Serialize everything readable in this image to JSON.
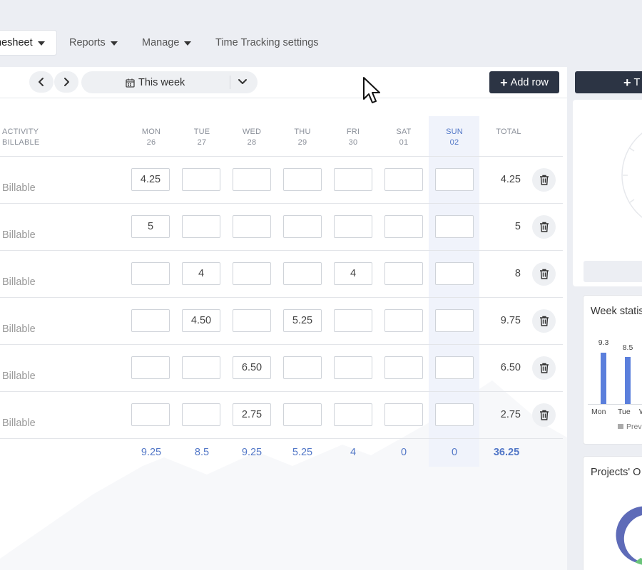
{
  "nav": {
    "tabs": [
      {
        "label": "nesheet",
        "active": true
      },
      {
        "label": "Reports",
        "active": false
      },
      {
        "label": "Manage",
        "active": false
      },
      {
        "label": "Time Tracking settings",
        "active": false
      }
    ]
  },
  "toolbar": {
    "week_label": "This week",
    "add_row_label": "Add row"
  },
  "table": {
    "activity_header": "ACTIVITY",
    "activity_subheader": "BILLABLE",
    "days": [
      {
        "name": "MON",
        "date": "26"
      },
      {
        "name": "TUE",
        "date": "27"
      },
      {
        "name": "WED",
        "date": "28"
      },
      {
        "name": "THU",
        "date": "29"
      },
      {
        "name": "FRI",
        "date": "30"
      },
      {
        "name": "SAT",
        "date": "01"
      },
      {
        "name": "SUN",
        "date": "02"
      }
    ],
    "total_header": "TOTAL",
    "rows": [
      {
        "label": "Billable",
        "cells": [
          "4.25",
          "",
          "",
          "",
          "",
          "",
          ""
        ],
        "total": "4.25"
      },
      {
        "label": "Billable",
        "cells": [
          "5",
          "",
          "",
          "",
          "",
          "",
          ""
        ],
        "total": "5"
      },
      {
        "label": "Billable",
        "cells": [
          "",
          "4",
          "",
          "",
          "4",
          "",
          ""
        ],
        "total": "8"
      },
      {
        "label": "Billable",
        "cells": [
          "",
          "4.50",
          "",
          "5.25",
          "",
          "",
          ""
        ],
        "total": "9.75"
      },
      {
        "label": "Billable",
        "cells": [
          "",
          "",
          "6.50",
          "",
          "",
          "",
          ""
        ],
        "total": "6.50"
      },
      {
        "label": "Billable",
        "cells": [
          "",
          "",
          "2.75",
          "",
          "",
          "",
          ""
        ],
        "total": "2.75"
      }
    ],
    "day_totals": [
      "9.25",
      "8.5",
      "9.25",
      "5.25",
      "4",
      "0",
      "0"
    ],
    "grand_total": "36.25"
  },
  "sidebar": {
    "button_label": "T",
    "week_stats": {
      "title": "Week statis",
      "bars": [
        {
          "day": "Mon",
          "value": "9.3"
        },
        {
          "day": "Tue",
          "value": "8.5"
        },
        {
          "day": "W",
          "value": ""
        }
      ],
      "legend": "Prev"
    },
    "projects": {
      "title": "Projects' O"
    }
  },
  "colors": {
    "accent": "#5277c7",
    "dark_button": "#2c3444",
    "bar": "#5b7fdc"
  }
}
